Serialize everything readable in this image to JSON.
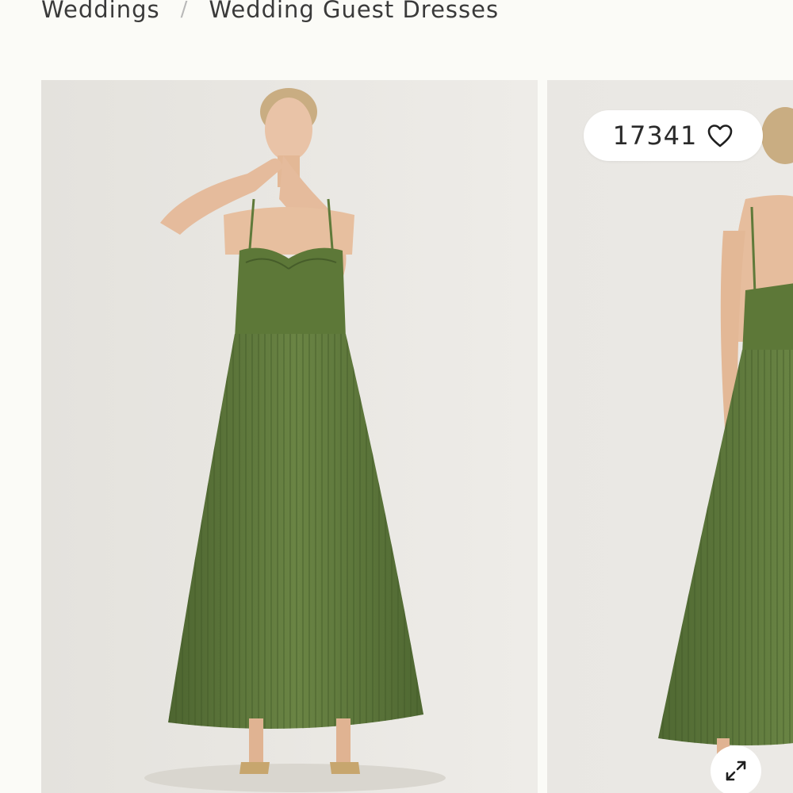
{
  "breadcrumb": {
    "items": [
      {
        "label": "Weddings"
      },
      {
        "label": "Wedding Guest Dresses"
      }
    ],
    "separator": "/"
  },
  "gallery": {
    "likes": {
      "count": "17341",
      "icon": "heart-icon"
    },
    "expand": {
      "icon": "expand-icon"
    },
    "images": [
      {
        "name": "front-view",
        "dress_color": "#5f7a3a",
        "background": "#e9e7e3"
      },
      {
        "name": "back-view",
        "dress_color": "#5f7a3a",
        "background": "#e9e7e3"
      }
    ]
  }
}
